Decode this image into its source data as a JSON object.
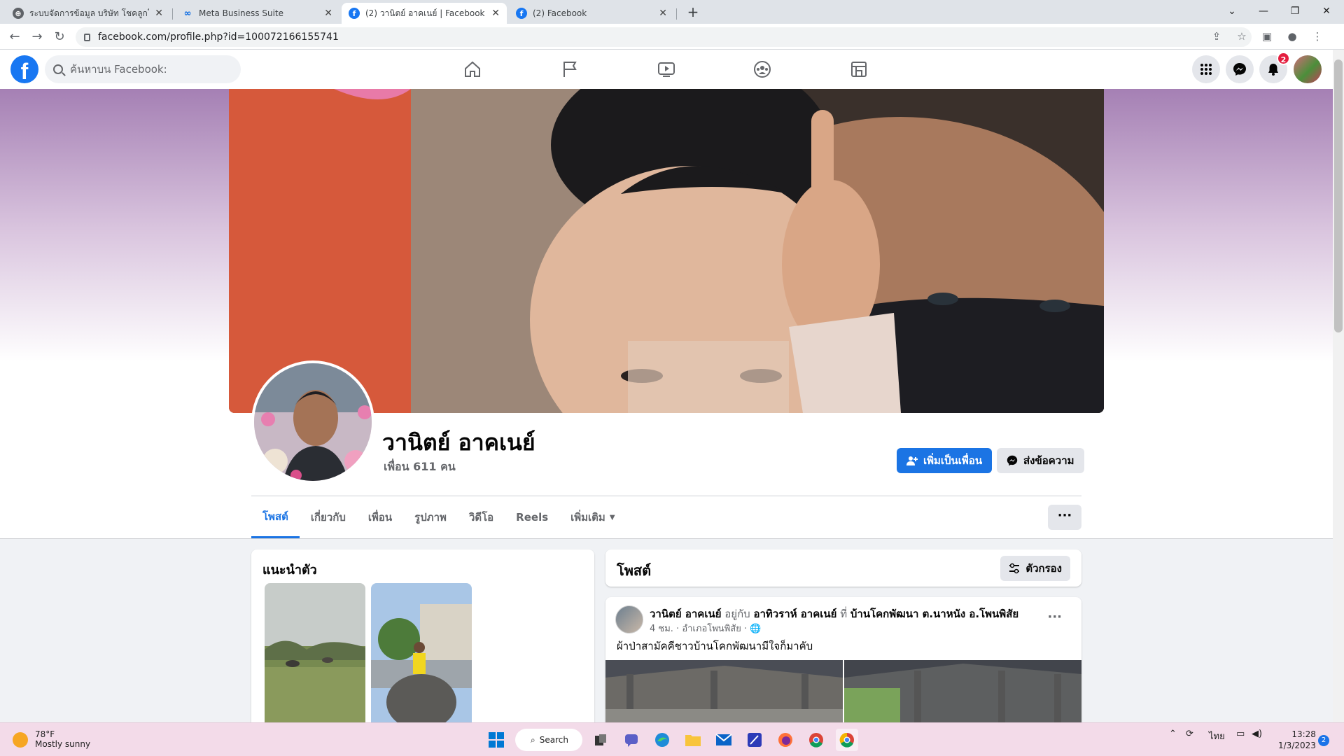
{
  "browser": {
    "tabs": [
      {
        "title": "ระบบจัดการข้อมูล บริษัท โชคลูกโชค",
        "active": false,
        "icon": "chrome-globe-icon"
      },
      {
        "title": "Meta Business Suite",
        "active": false,
        "icon": "meta-icon"
      },
      {
        "title": "(2) วานิตย์ อาคเนย์ | Facebook",
        "active": true,
        "icon": "facebook-icon"
      },
      {
        "title": "(2) Facebook",
        "active": false,
        "icon": "facebook-icon"
      }
    ],
    "new_tab": "+",
    "url": "facebook.com/profile.php?id=100072166155741"
  },
  "fb_header": {
    "logo": "f",
    "search_placeholder": "ค้นหาบน Facebook:",
    "nav_icons": [
      "home-icon",
      "pages-flag-icon",
      "watch-video-icon",
      "groups-icon",
      "gaming-icon"
    ],
    "notification_count": "2"
  },
  "profile": {
    "name": "วานิตย์ อาคเนย์",
    "friends": "เพื่อน 611 คน",
    "add_friend_label": "เพิ่มเป็นเพื่อน",
    "message_label": "ส่งข้อความ",
    "tabs": [
      {
        "label": "โพสต์",
        "active": true
      },
      {
        "label": "เกี่ยวกับ",
        "active": false
      },
      {
        "label": "เพื่อน",
        "active": false
      },
      {
        "label": "รูปภาพ",
        "active": false
      },
      {
        "label": "วิดีโอ",
        "active": false
      },
      {
        "label": "Reels",
        "active": false
      },
      {
        "label": "เพิ่มเติม",
        "active": false
      }
    ],
    "more_label": "···"
  },
  "intro": {
    "title": "แนะนำตัว"
  },
  "posts": {
    "title": "โพสต์",
    "filter_label": "ตัวกรอง",
    "post": {
      "author": "วานิตย์ อาคเนย์",
      "with_word": "อยู่กับ",
      "tagged": "อาทิวราห์ อาคเนย์",
      "at_word": "ที่",
      "location": "บ้านโคกพัฒนา ต.นาหนัง อ.โพนพิสัย",
      "meta": "4 ชม. · อำเภอโพนพิสัย ·",
      "text": "ผ้าป่าสามัคคีชาวบ้านโคกพัฒนามีใจก็มาคับ",
      "more": "···"
    }
  },
  "taskbar": {
    "weather_temp": "78°F",
    "weather_desc": "Mostly sunny",
    "search_label": "Search",
    "language": "ไทย",
    "time": "13:28",
    "date": "1/3/2023",
    "notif_count": "2"
  },
  "colors": {
    "fb_blue": "#1877f2",
    "button_blue": "#1b74e4",
    "taskbar_bg": "#f3dbe9"
  }
}
